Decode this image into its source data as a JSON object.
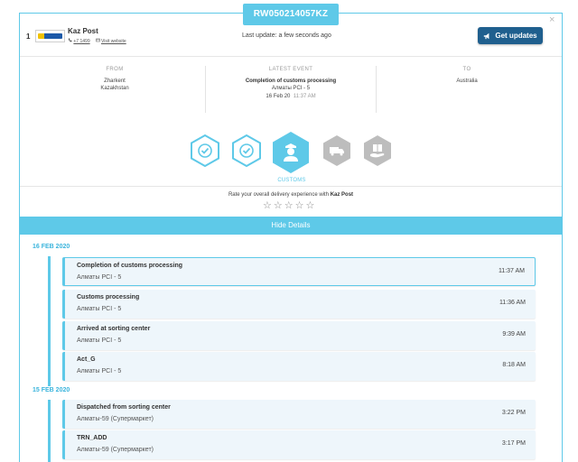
{
  "tracking_number": "RW050214057KZ",
  "close_symbol": "×",
  "carrier": {
    "index": "1",
    "name": "Kaz Post",
    "phone": "+7 1499",
    "visit_link": "Visit website",
    "logo_brand_colors": [
      "#f2c200",
      "#1e5aa8"
    ]
  },
  "last_update": "Last update:  a few seconds ago",
  "get_updates_label": "Get updates",
  "route": {
    "from_header": "FROM",
    "from_line1": "Zharkent",
    "from_line2": "Kazakhstan",
    "latest_header": "LATEST EVENT",
    "latest_event": "Completion of customs processing",
    "latest_location": "Алматы PCI - 5",
    "latest_date": "16 Feb 20",
    "latest_time": "11:37 AM",
    "to_header": "TO",
    "to_line1": "Australia"
  },
  "status_steps": [
    {
      "icon": "check-icon",
      "state": "done"
    },
    {
      "icon": "check-icon",
      "state": "done"
    },
    {
      "icon": "customs-officer-icon",
      "state": "current"
    },
    {
      "icon": "delivery-truck-icon",
      "state": "pending"
    },
    {
      "icon": "package-delivered-icon",
      "state": "pending"
    }
  ],
  "status_label": "CUSTOMS",
  "rating": {
    "prefix": "Rate your overall delivery experience with",
    "carrier": "Kaz Post",
    "star_symbol": "☆"
  },
  "hide_details_label": "Hide Details",
  "colors": {
    "accent": "#5ec9e8",
    "button": "#1f5f8e",
    "pending": "#bdbdbd"
  },
  "timeline": [
    {
      "date": "16 FEB 2020",
      "events": [
        {
          "title": "Completion of customs processing",
          "location": "Алматы PCI - 5",
          "time": "11:37 AM"
        },
        {
          "title": "Customs processing",
          "location": "Алматы PCI - 5",
          "time": "11:36 AM"
        },
        {
          "title": "Arrived at sorting center",
          "location": "Алматы PCI - 5",
          "time": "9:39 AM"
        },
        {
          "title": "Act_G",
          "location": "Алматы PCI - 5",
          "time": "8:18 AM"
        }
      ]
    },
    {
      "date": "15 FEB 2020",
      "events": [
        {
          "title": "Dispatched from sorting center",
          "location": "Алматы-59 (Супермаркет)",
          "time": "3:22 PM"
        },
        {
          "title": "TRN_ADD",
          "location": "Алматы-59 (Супермаркет)",
          "time": "3:17 PM"
        }
      ]
    }
  ]
}
